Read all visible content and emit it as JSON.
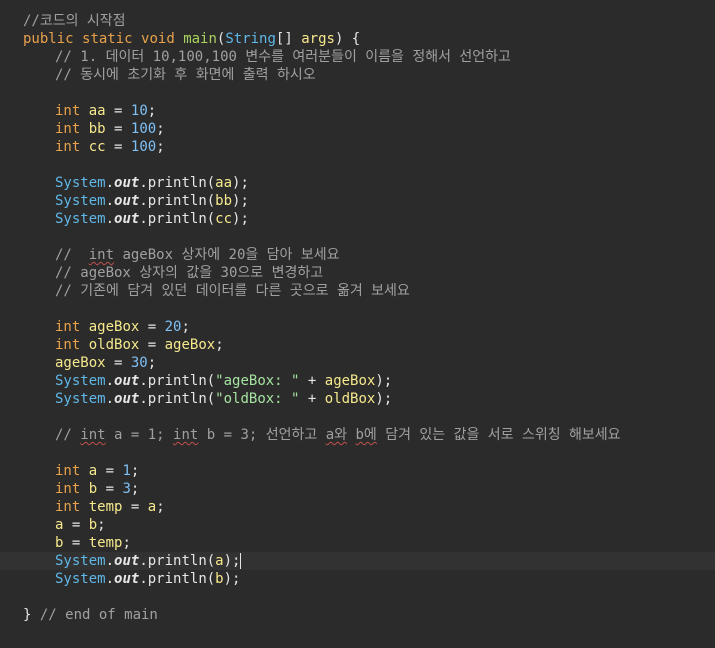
{
  "editor": {
    "lines": [
      {
        "indent": 1,
        "tokens": [
          {
            "t": "comment",
            "v": "//코드의 시작점"
          }
        ]
      },
      {
        "indent": 1,
        "tokens": [
          {
            "t": "keyword",
            "v": "public"
          },
          {
            "t": "plain",
            "v": " "
          },
          {
            "t": "keyword",
            "v": "static"
          },
          {
            "t": "plain",
            "v": " "
          },
          {
            "t": "keyword",
            "v": "void"
          },
          {
            "t": "plain",
            "v": " "
          },
          {
            "t": "main",
            "v": "main"
          },
          {
            "t": "plain",
            "v": "("
          },
          {
            "t": "class",
            "v": "String"
          },
          {
            "t": "plain",
            "v": "[] "
          },
          {
            "t": "ident",
            "v": "args"
          },
          {
            "t": "plain",
            "v": ") {"
          }
        ]
      },
      {
        "indent": 2,
        "tokens": [
          {
            "t": "comment",
            "v": "// 1. 데이터 10,100,100 변수를 여러분들이 이름을 정해서 선언하고"
          }
        ]
      },
      {
        "indent": 2,
        "tokens": [
          {
            "t": "comment",
            "v": "// 동시에 초기화 후 화면에 출력 하시오"
          }
        ]
      },
      {
        "indent": 2,
        "tokens": []
      },
      {
        "indent": 2,
        "tokens": [
          {
            "t": "keyword",
            "v": "int"
          },
          {
            "t": "plain",
            "v": " "
          },
          {
            "t": "ident",
            "v": "aa"
          },
          {
            "t": "plain",
            "v": " = "
          },
          {
            "t": "number",
            "v": "10"
          },
          {
            "t": "plain",
            "v": ";"
          }
        ]
      },
      {
        "indent": 2,
        "tokens": [
          {
            "t": "keyword",
            "v": "int"
          },
          {
            "t": "plain",
            "v": " "
          },
          {
            "t": "ident",
            "v": "bb"
          },
          {
            "t": "plain",
            "v": " = "
          },
          {
            "t": "number",
            "v": "100"
          },
          {
            "t": "plain",
            "v": ";"
          }
        ]
      },
      {
        "indent": 2,
        "tokens": [
          {
            "t": "keyword",
            "v": "int"
          },
          {
            "t": "plain",
            "v": " "
          },
          {
            "t": "ident",
            "v": "cc"
          },
          {
            "t": "plain",
            "v": " = "
          },
          {
            "t": "number",
            "v": "100"
          },
          {
            "t": "plain",
            "v": ";"
          }
        ]
      },
      {
        "indent": 2,
        "tokens": []
      },
      {
        "indent": 2,
        "tokens": [
          {
            "t": "class",
            "v": "System"
          },
          {
            "t": "plain",
            "v": "."
          },
          {
            "t": "field",
            "v": "out"
          },
          {
            "t": "plain",
            "v": ".println("
          },
          {
            "t": "ident",
            "v": "aa"
          },
          {
            "t": "plain",
            "v": ");"
          }
        ]
      },
      {
        "indent": 2,
        "tokens": [
          {
            "t": "class",
            "v": "System"
          },
          {
            "t": "plain",
            "v": "."
          },
          {
            "t": "field",
            "v": "out"
          },
          {
            "t": "plain",
            "v": ".println("
          },
          {
            "t": "ident",
            "v": "bb"
          },
          {
            "t": "plain",
            "v": ");"
          }
        ]
      },
      {
        "indent": 2,
        "tokens": [
          {
            "t": "class",
            "v": "System"
          },
          {
            "t": "plain",
            "v": "."
          },
          {
            "t": "field",
            "v": "out"
          },
          {
            "t": "plain",
            "v": ".println("
          },
          {
            "t": "ident",
            "v": "cc"
          },
          {
            "t": "plain",
            "v": ");"
          }
        ]
      },
      {
        "indent": 2,
        "tokens": []
      },
      {
        "indent": 2,
        "tokens": [
          {
            "t": "comment",
            "v": "//  "
          },
          {
            "t": "kwcomment",
            "v": "int"
          },
          {
            "t": "comment",
            "v": " ageBox 상자에 20을 담아 보세요"
          }
        ]
      },
      {
        "indent": 2,
        "tokens": [
          {
            "t": "comment",
            "v": "// ageBox 상자의 값을 30으로 변경하고"
          }
        ]
      },
      {
        "indent": 2,
        "tokens": [
          {
            "t": "comment",
            "v": "// 기존에 담겨 있던 데이터를 다른 곳으로 옮겨 보세요"
          }
        ]
      },
      {
        "indent": 2,
        "tokens": []
      },
      {
        "indent": 2,
        "tokens": [
          {
            "t": "keyword",
            "v": "int"
          },
          {
            "t": "plain",
            "v": " "
          },
          {
            "t": "ident",
            "v": "ageBox"
          },
          {
            "t": "plain",
            "v": " = "
          },
          {
            "t": "number",
            "v": "20"
          },
          {
            "t": "plain",
            "v": ";"
          }
        ]
      },
      {
        "indent": 2,
        "tokens": [
          {
            "t": "keyword",
            "v": "int"
          },
          {
            "t": "plain",
            "v": " "
          },
          {
            "t": "ident",
            "v": "oldBox"
          },
          {
            "t": "plain",
            "v": " = "
          },
          {
            "t": "ident",
            "v": "ageBox"
          },
          {
            "t": "plain",
            "v": ";"
          }
        ]
      },
      {
        "indent": 2,
        "tokens": [
          {
            "t": "ident",
            "v": "ageBox"
          },
          {
            "t": "plain",
            "v": " = "
          },
          {
            "t": "number",
            "v": "30"
          },
          {
            "t": "plain",
            "v": ";"
          }
        ]
      },
      {
        "indent": 2,
        "tokens": [
          {
            "t": "class",
            "v": "System"
          },
          {
            "t": "plain",
            "v": "."
          },
          {
            "t": "field",
            "v": "out"
          },
          {
            "t": "plain",
            "v": ".println("
          },
          {
            "t": "string",
            "v": "\"ageBox: \""
          },
          {
            "t": "plain",
            "v": " + "
          },
          {
            "t": "ident",
            "v": "ageBox"
          },
          {
            "t": "plain",
            "v": ");"
          }
        ]
      },
      {
        "indent": 2,
        "tokens": [
          {
            "t": "class",
            "v": "System"
          },
          {
            "t": "plain",
            "v": "."
          },
          {
            "t": "field",
            "v": "out"
          },
          {
            "t": "plain",
            "v": ".println("
          },
          {
            "t": "string",
            "v": "\"oldBox: \""
          },
          {
            "t": "plain",
            "v": " + "
          },
          {
            "t": "ident",
            "v": "oldBox"
          },
          {
            "t": "plain",
            "v": ");"
          }
        ]
      },
      {
        "indent": 2,
        "tokens": []
      },
      {
        "indent": 2,
        "tokens": [
          {
            "t": "comment",
            "v": "// "
          },
          {
            "t": "kwcomment",
            "v": "int"
          },
          {
            "t": "comment",
            "v": " a = 1; "
          },
          {
            "t": "kwcomment",
            "v": "int"
          },
          {
            "t": "comment",
            "v": " b = 3; 선언하고 "
          },
          {
            "t": "kwcomment",
            "v": "a와"
          },
          {
            "t": "comment",
            "v": " "
          },
          {
            "t": "kwcomment",
            "v": "b에"
          },
          {
            "t": "comment",
            "v": " 담겨 있는 값을 서로 스위칭 해보세요"
          }
        ]
      },
      {
        "indent": 2,
        "tokens": []
      },
      {
        "indent": 2,
        "tokens": [
          {
            "t": "keyword",
            "v": "int"
          },
          {
            "t": "plain",
            "v": " "
          },
          {
            "t": "ident",
            "v": "a"
          },
          {
            "t": "plain",
            "v": " = "
          },
          {
            "t": "number",
            "v": "1"
          },
          {
            "t": "plain",
            "v": ";"
          }
        ]
      },
      {
        "indent": 2,
        "tokens": [
          {
            "t": "keyword",
            "v": "int"
          },
          {
            "t": "plain",
            "v": " "
          },
          {
            "t": "ident",
            "v": "b"
          },
          {
            "t": "plain",
            "v": " = "
          },
          {
            "t": "number",
            "v": "3"
          },
          {
            "t": "plain",
            "v": ";"
          }
        ]
      },
      {
        "indent": 2,
        "tokens": [
          {
            "t": "keyword",
            "v": "int"
          },
          {
            "t": "plain",
            "v": " "
          },
          {
            "t": "ident",
            "v": "temp"
          },
          {
            "t": "plain",
            "v": " = "
          },
          {
            "t": "ident",
            "v": "a"
          },
          {
            "t": "plain",
            "v": ";"
          }
        ]
      },
      {
        "indent": 2,
        "tokens": [
          {
            "t": "ident",
            "v": "a"
          },
          {
            "t": "plain",
            "v": " = "
          },
          {
            "t": "ident",
            "v": "b"
          },
          {
            "t": "plain",
            "v": ";"
          }
        ]
      },
      {
        "indent": 2,
        "tokens": [
          {
            "t": "ident",
            "v": "b"
          },
          {
            "t": "plain",
            "v": " = "
          },
          {
            "t": "ident",
            "v": "temp"
          },
          {
            "t": "plain",
            "v": ";"
          }
        ]
      },
      {
        "indent": 2,
        "current": true,
        "caret": true,
        "tokens": [
          {
            "t": "class",
            "v": "System"
          },
          {
            "t": "plain",
            "v": "."
          },
          {
            "t": "field",
            "v": "out"
          },
          {
            "t": "plain",
            "v": ".println("
          },
          {
            "t": "ident",
            "v": "a"
          },
          {
            "t": "plain",
            "v": ");"
          }
        ]
      },
      {
        "indent": 2,
        "tokens": [
          {
            "t": "class",
            "v": "System"
          },
          {
            "t": "plain",
            "v": "."
          },
          {
            "t": "field",
            "v": "out"
          },
          {
            "t": "plain",
            "v": ".println("
          },
          {
            "t": "ident",
            "v": "b"
          },
          {
            "t": "plain",
            "v": ");"
          }
        ]
      },
      {
        "indent": 2,
        "tokens": []
      },
      {
        "indent": 1,
        "tokens": [
          {
            "t": "plain",
            "v": "} "
          },
          {
            "t": "comment",
            "v": "// end of main"
          }
        ]
      }
    ]
  },
  "colors": {
    "background": "#2b2b2b",
    "current_line": "#323232",
    "comment": "#a0a0a0",
    "keyword": "#e8a24c",
    "identifier": "#f6e98c",
    "method_name": "#a9d25e",
    "number": "#7fc0f5",
    "class": "#5fb7e8",
    "string": "#a5e3a0",
    "plain": "#e6e6e6"
  }
}
